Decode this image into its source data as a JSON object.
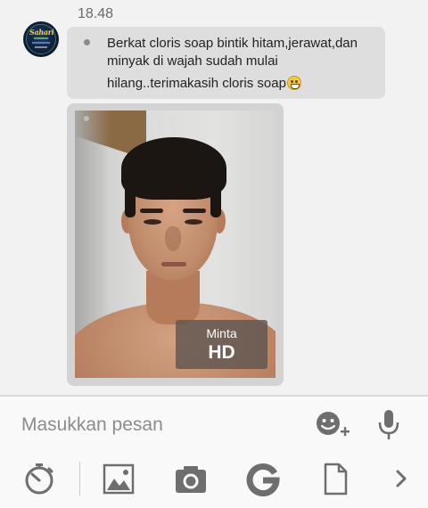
{
  "conversation": {
    "timestamp": "18.48",
    "message": {
      "line1": "Berkat cloris soap bintik hitam,jerawat,dan",
      "line2": "minyak di wajah sudah mulai",
      "line3": "hilang..terimakasih cloris soap",
      "emoji": "grinning-face-emoji"
    },
    "image": {
      "hd_label_top": "Minta",
      "hd_label_bottom": "HD"
    }
  },
  "composer": {
    "placeholder": "Masukkan pesan",
    "value": ""
  },
  "toolbar": {
    "items": [
      "timer-icon",
      "gallery-icon",
      "camera-icon",
      "gif-icon",
      "file-icon",
      "chevron-right-icon"
    ]
  },
  "colors": {
    "background": "#f2f2f2",
    "bubble": "#dedede",
    "icon": "#6e6e6e"
  }
}
